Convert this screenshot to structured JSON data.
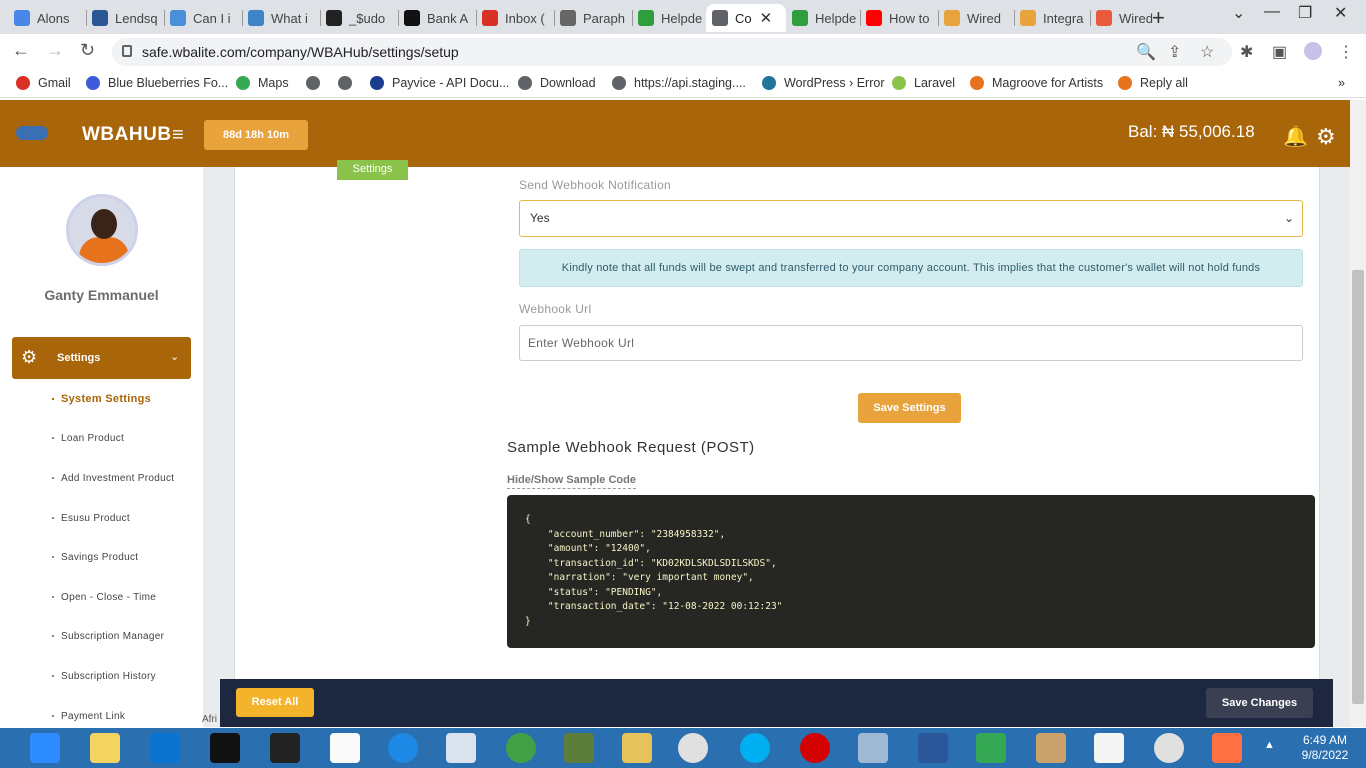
{
  "browser": {
    "tabs": [
      {
        "label": "Alons",
        "color": "#4a86e8"
      },
      {
        "label": "Lendsq",
        "color": "#2b5797"
      },
      {
        "label": "Can I i",
        "color": "#4a90d9"
      },
      {
        "label": "What i",
        "color": "#3d85c6"
      },
      {
        "label": "_$udo",
        "color": "#222222"
      },
      {
        "label": "Bank A",
        "color": "#111111"
      },
      {
        "label": "Inbox (",
        "color": "#d93025"
      },
      {
        "label": "Paraph",
        "color": "#666666"
      },
      {
        "label": "Helpde",
        "color": "#2e9e3f"
      },
      {
        "label": "Co",
        "color": "#5f6368",
        "active": true
      },
      {
        "label": "Helpde",
        "color": "#2e9e3f"
      },
      {
        "label": "How to",
        "color": "#ff0000"
      },
      {
        "label": "Wired",
        "color": "#e8a33c"
      },
      {
        "label": "Integra",
        "color": "#e8a33c"
      },
      {
        "label": "Wired",
        "color": "#e85a3c"
      }
    ],
    "url": "safe.wbalite.com/company/WBAHub/settings/setup",
    "bookmarks": [
      {
        "label": "Gmail",
        "color": "#d93025"
      },
      {
        "label": "Blue Blueberries Fo...",
        "color": "#3b5bdb"
      },
      {
        "label": "Maps",
        "color": "#34a853"
      },
      {
        "label": "",
        "color": "#5f6368"
      },
      {
        "label": "",
        "color": "#5f6368"
      },
      {
        "label": "Payvice - API Docu...",
        "color": "#1a3d8f"
      },
      {
        "label": "Download",
        "color": "#5f6368"
      },
      {
        "label": "https://api.staging....",
        "color": "#5f6368"
      },
      {
        "label": "WordPress › Error",
        "color": "#21759b"
      },
      {
        "label": "Laravel",
        "color": "#8bc34a"
      },
      {
        "label": "Magroove for Artists",
        "color": "#e8731d"
      },
      {
        "label": "Reply all",
        "color": "#e8731d"
      }
    ]
  },
  "header": {
    "brand": "WBAHUB",
    "timer": "88d 18h 10m",
    "balance": "Bal: ₦ 55,006.18"
  },
  "sidebar": {
    "username": "Ganty Emmanuel",
    "settings_label": "Settings",
    "items": [
      {
        "label": "System Settings",
        "active": true
      },
      {
        "label": "Loan Product"
      },
      {
        "label": "Add Investment Product"
      },
      {
        "label": "Esusu Product"
      },
      {
        "label": "Savings Product"
      },
      {
        "label": "Open - Close - Time"
      },
      {
        "label": "Subscription Manager"
      },
      {
        "label": "Subscription History"
      },
      {
        "label": "Payment Link"
      }
    ]
  },
  "main": {
    "settings_tab": "Settings",
    "webhook_notification_label": "Send Webhook Notification",
    "webhook_notification_value": "Yes",
    "notice": "Kindly note that all funds will be swept and transferred to your company account. This implies that the customer's wallet will not hold funds",
    "webhook_url_label": "Webhook Url",
    "webhook_url_placeholder": "Enter Webhook Url",
    "save_settings": "Save Settings",
    "sample_title": "Sample Webhook Request (POST)",
    "hide_show": "Hide/Show Sample Code",
    "sample_code": "{\n    \"account_number\": \"2384958332\",\n    \"amount\": \"12400\",\n    \"transaction_id\": \"KD02KDLSKDLSDILSKDS\",\n    \"narration\": \"very important money\",\n    \"status\": \"PENDING\",\n    \"transaction_date\": \"12-08-2022 00:12:23\"\n}"
  },
  "bottom": {
    "reset_all": "Reset All",
    "save_changes": "Save Changes",
    "partial_text": "Afri"
  },
  "taskbar": {
    "time": "6:49 AM",
    "date": "9/8/2022"
  }
}
